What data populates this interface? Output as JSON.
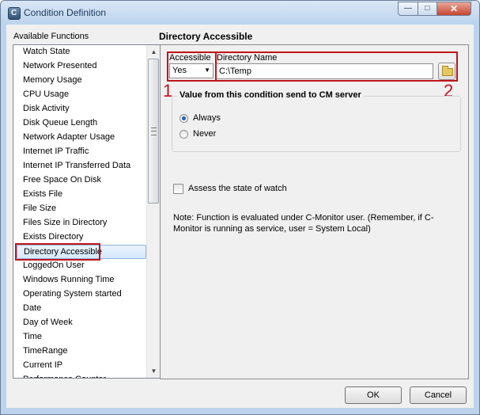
{
  "window": {
    "title": "Condition Definition",
    "app_icon_letter": "C",
    "controls": {
      "minimize": "—",
      "maximize": "□",
      "close": "✕"
    }
  },
  "functions": {
    "label": "Available Functions",
    "items": [
      "Watch State",
      "Network Presented",
      "Memory Usage",
      "CPU Usage",
      "Disk Activity",
      "Disk Queue Length",
      "Network Adapter Usage",
      "Internet IP Traffic",
      "Internet IP Transferred Data",
      "Free Space On Disk",
      "Exists File",
      "File Size",
      "Files Size in Directory",
      "Exists Directory",
      "Directory Accessible",
      "LoggedOn User",
      "Windows Running Time",
      "Operating System started",
      "Date",
      "Day of Week",
      "Time",
      "TimeRange",
      "Current IP",
      "Performance Counter"
    ],
    "selected_index": 14
  },
  "panel": {
    "title": "Directory Accessible",
    "accessible": {
      "label": "Accessible",
      "value": "Yes"
    },
    "directory": {
      "label": "Directory Name",
      "value": "C:\\Temp"
    },
    "callouts": [
      "1",
      "2"
    ],
    "group": {
      "title": "Value from this condition send to CM server",
      "options": [
        "Always",
        "Never"
      ],
      "selected": "Always"
    },
    "assess": {
      "label": "Assess the state of watch",
      "checked": false
    },
    "note": "Note: Function is evaluated under C-Monitor user. (Remember, if C-Monitor is running as service, user = System Local)"
  },
  "buttons": {
    "ok": "OK",
    "cancel": "Cancel"
  },
  "colors": {
    "highlight": "#c0141b",
    "selection": "#d6e9fb",
    "radio_dot": "#1f5fbd"
  }
}
